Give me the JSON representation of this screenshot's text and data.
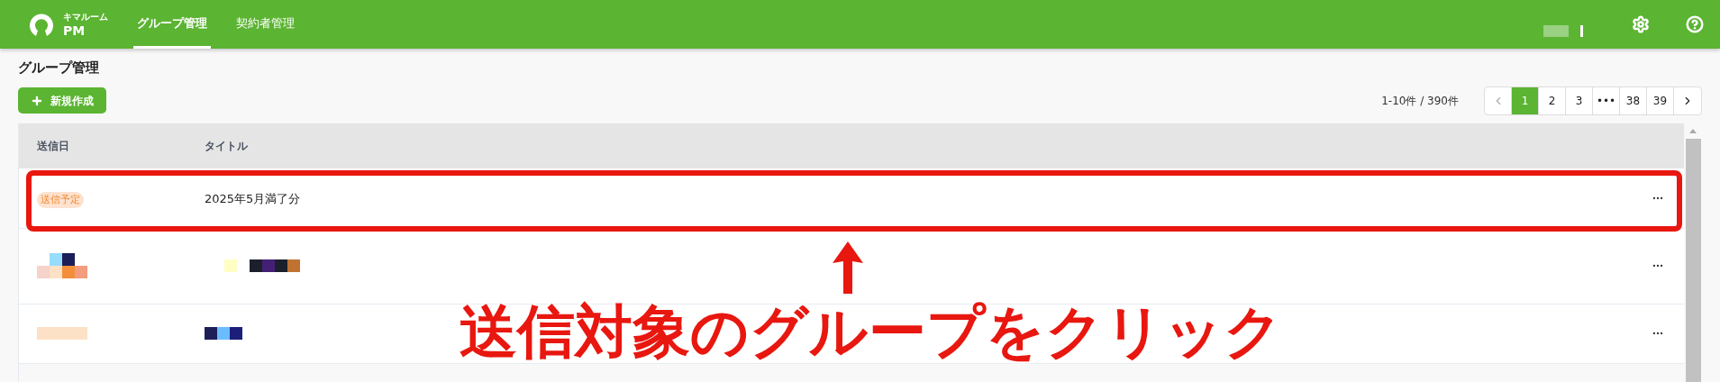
{
  "header": {
    "logo_caption": "キマルーム",
    "logo_text": "PM",
    "nav": [
      {
        "label": "グループ管理",
        "selected": true
      },
      {
        "label": "契約者管理",
        "selected": false
      }
    ]
  },
  "page_title": "グループ管理",
  "new_button": {
    "label": "新規作成"
  },
  "pagination": {
    "summary": "1-10件 / 390件",
    "pages": [
      {
        "label": "1",
        "selected": true
      },
      {
        "label": "2",
        "selected": false
      },
      {
        "label": "3",
        "selected": false
      },
      {
        "label": "•••",
        "selected": false
      },
      {
        "label": "38",
        "selected": false
      },
      {
        "label": "39",
        "selected": false
      }
    ]
  },
  "table": {
    "columns": [
      "送信日",
      "タイトル"
    ],
    "rows": [
      {
        "kind": "scheduled",
        "status": "送信予定",
        "title": "2025年5月満了分",
        "outlined": true
      },
      {
        "kind": "redacted",
        "outlined": false
      },
      {
        "kind": "redacted",
        "outlined": false
      }
    ]
  },
  "annotation": {
    "text": "送信対象のグループをクリック"
  }
}
